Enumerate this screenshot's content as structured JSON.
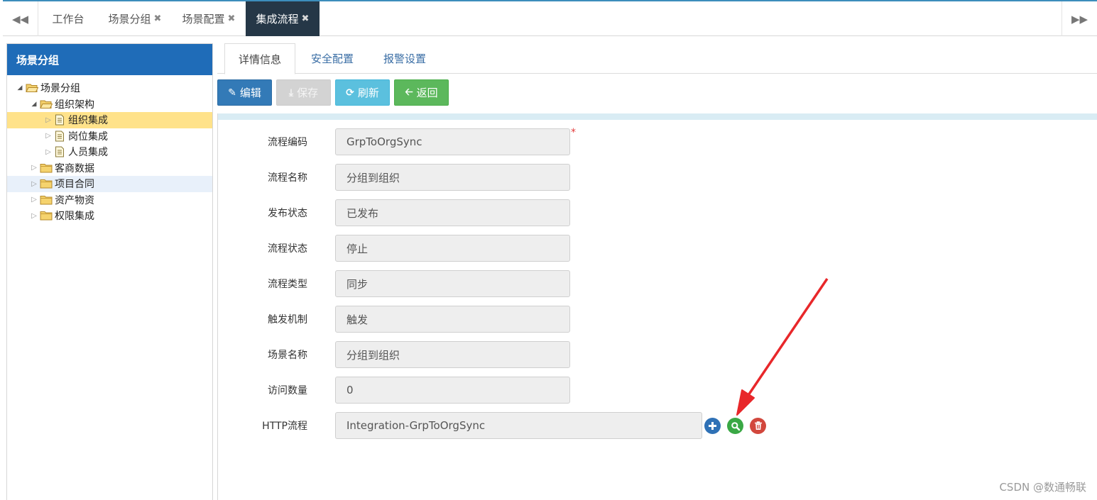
{
  "topbar": {
    "tabs": [
      {
        "label": "工作台",
        "closable": false
      },
      {
        "label": "场景分组",
        "closable": true
      },
      {
        "label": "场景配置",
        "closable": true
      },
      {
        "label": "集成流程",
        "closable": true,
        "active": true
      }
    ],
    "close_glyph": "✖"
  },
  "sidebar": {
    "title": "场景分组",
    "tree": [
      {
        "label": "场景分组",
        "level": 0,
        "type": "folder-open",
        "expanded": true
      },
      {
        "label": "组织架构",
        "level": 1,
        "type": "folder-open",
        "expanded": true
      },
      {
        "label": "组织集成",
        "level": 2,
        "type": "file",
        "selected": true
      },
      {
        "label": "岗位集成",
        "level": 2,
        "type": "file"
      },
      {
        "label": "人员集成",
        "level": 2,
        "type": "file"
      },
      {
        "label": "客商数据",
        "level": 1,
        "type": "folder"
      },
      {
        "label": "项目合同",
        "level": 1,
        "type": "folder",
        "hover": true
      },
      {
        "label": "资产物资",
        "level": 1,
        "type": "folder"
      },
      {
        "label": "权限集成",
        "level": 1,
        "type": "folder"
      }
    ]
  },
  "subtabs": [
    {
      "label": "详情信息",
      "active": true
    },
    {
      "label": "安全配置"
    },
    {
      "label": "报警设置"
    }
  ],
  "toolbar": {
    "edit_label": "编辑",
    "save_label": "保存",
    "refresh_label": "刷新",
    "back_label": "返回"
  },
  "form": {
    "fields": [
      {
        "label": "流程编码",
        "value": "GrpToOrgSync",
        "required": true
      },
      {
        "label": "流程名称",
        "value": "分组到组织"
      },
      {
        "label": "发布状态",
        "value": "已发布"
      },
      {
        "label": "流程状态",
        "value": "停止"
      },
      {
        "label": "流程类型",
        "value": "同步"
      },
      {
        "label": "触发机制",
        "value": "触发"
      },
      {
        "label": "场景名称",
        "value": "分组到组织"
      },
      {
        "label": "访问数量",
        "value": "0"
      },
      {
        "label": "HTTP流程",
        "value": "Integration-GrpToOrgSync"
      }
    ],
    "required_mark": "*"
  },
  "colors": {
    "accent": "#1f6cb8",
    "active_tab": "#253747",
    "edit": "#337ab7",
    "refresh": "#5bc0de",
    "back": "#5cb85c",
    "delete": "#d2473d",
    "arrow": "#e8272a"
  },
  "watermark": "CSDN @数通畅联"
}
